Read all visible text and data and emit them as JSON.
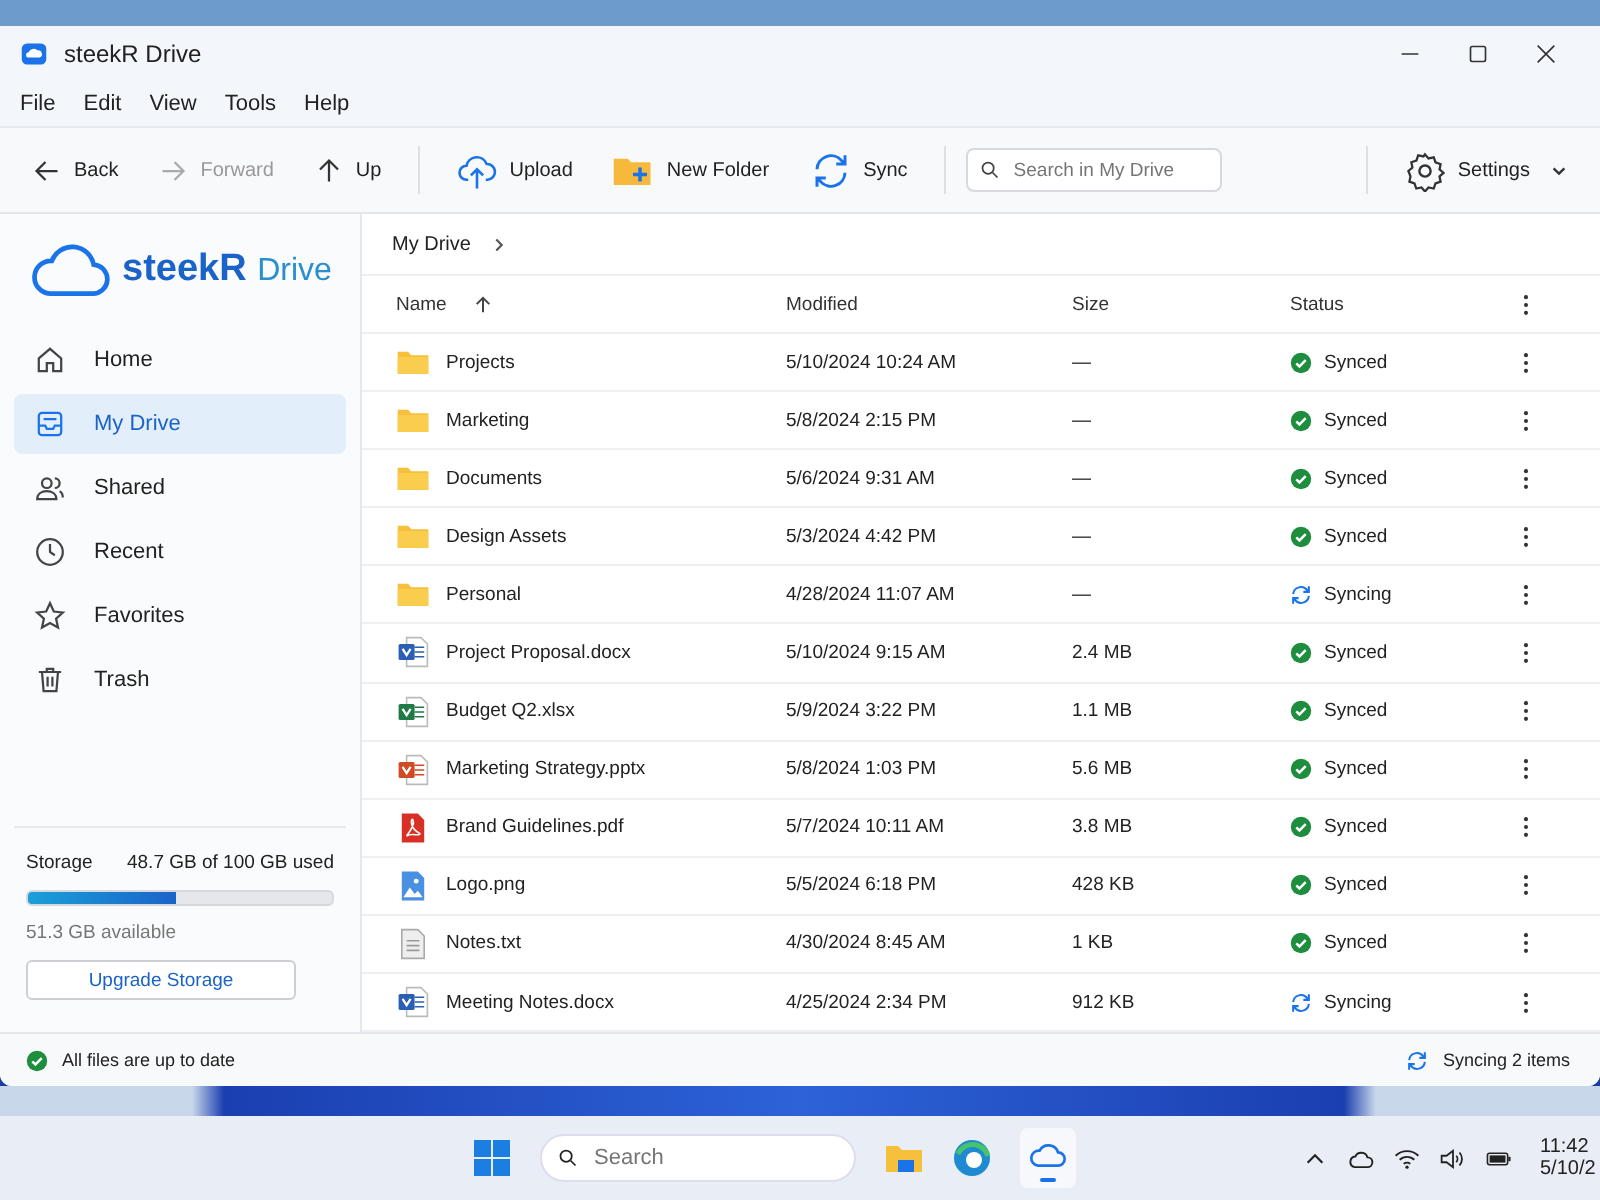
{
  "window": {
    "title": "steekR Drive"
  },
  "menu": [
    "File",
    "Edit",
    "View",
    "Tools",
    "Help"
  ],
  "toolbar": [
    {
      "kind": "back",
      "label": "Back",
      "disabled": false
    },
    {
      "kind": "forward",
      "label": "Forward",
      "disabled": true
    },
    {
      "kind": "up",
      "label": "Up",
      "disabled": false
    },
    {
      "kind": "upload",
      "label": "Upload",
      "disabled": false
    },
    {
      "kind": "newfolder",
      "label": "New Folder",
      "disabled": false
    },
    {
      "kind": "sync",
      "label": "Sync",
      "disabled": false
    }
  ],
  "search": {
    "placeholder": "Search in My Drive"
  },
  "settings": {
    "label": "Settings"
  },
  "logo": {
    "name": "steekR",
    "suffix": "Drive"
  },
  "sidebar": {
    "items": [
      {
        "kind": "home",
        "label": "Home",
        "selected": false
      },
      {
        "kind": "drive",
        "label": "My Drive",
        "selected": true
      },
      {
        "kind": "shared",
        "label": "Shared",
        "selected": false
      },
      {
        "kind": "recent",
        "label": "Recent",
        "selected": false
      },
      {
        "kind": "favorites",
        "label": "Favorites",
        "selected": false
      },
      {
        "kind": "trash",
        "label": "Trash",
        "selected": false
      }
    ]
  },
  "storage": {
    "label": "Storage",
    "used": "48.7 GB of 100 GB used",
    "level": 0.487,
    "available": "51.3 GB available",
    "button": "Upgrade Storage"
  },
  "breadcrumb": [
    "My Drive"
  ],
  "table": {
    "columns": [
      "Name",
      "Modified",
      "Size",
      "Status"
    ],
    "rows": [
      {
        "kind": "folder",
        "name": "Projects",
        "modified": "5/10/2024 10:24 AM",
        "size": "—",
        "status": {
          "kind": "synced",
          "label": "Synced"
        }
      },
      {
        "kind": "folder",
        "name": "Marketing",
        "modified": "5/8/2024 2:15 PM",
        "size": "—",
        "status": {
          "kind": "synced",
          "label": "Synced"
        }
      },
      {
        "kind": "folder",
        "name": "Documents",
        "modified": "5/6/2024 9:31 AM",
        "size": "—",
        "status": {
          "kind": "synced",
          "label": "Synced"
        }
      },
      {
        "kind": "folder",
        "name": "Design Assets",
        "modified": "5/3/2024 4:42 PM",
        "size": "—",
        "status": {
          "kind": "synced",
          "label": "Synced"
        }
      },
      {
        "kind": "folder",
        "name": "Personal",
        "modified": "4/28/2024 11:07 AM",
        "size": "—",
        "status": {
          "kind": "syncing",
          "label": "Syncing"
        }
      },
      {
        "kind": "word",
        "name": "Project Proposal.docx",
        "modified": "5/10/2024 9:15 AM",
        "size": "2.4 MB",
        "status": {
          "kind": "synced",
          "label": "Synced"
        }
      },
      {
        "kind": "excel",
        "name": "Budget Q2.xlsx",
        "modified": "5/9/2024 3:22 PM",
        "size": "1.1 MB",
        "status": {
          "kind": "synced",
          "label": "Synced"
        }
      },
      {
        "kind": "ppt",
        "name": "Marketing Strategy.pptx",
        "modified": "5/8/2024 1:03 PM",
        "size": "5.6 MB",
        "status": {
          "kind": "synced",
          "label": "Synced"
        }
      },
      {
        "kind": "pdf",
        "name": "Brand Guidelines.pdf",
        "modified": "5/7/2024 10:11 AM",
        "size": "3.8 MB",
        "status": {
          "kind": "synced",
          "label": "Synced"
        }
      },
      {
        "kind": "image",
        "name": "Logo.png",
        "modified": "5/5/2024 6:18 PM",
        "size": "428 KB",
        "status": {
          "kind": "synced",
          "label": "Synced"
        }
      },
      {
        "kind": "text",
        "name": "Notes.txt",
        "modified": "4/30/2024 8:45 AM",
        "size": "1 KB",
        "status": {
          "kind": "synced",
          "label": "Synced"
        }
      },
      {
        "kind": "word",
        "name": "Meeting Notes.docx",
        "modified": "4/25/2024 2:34 PM",
        "size": "912 KB",
        "status": {
          "kind": "syncing",
          "label": "Syncing"
        }
      }
    ]
  },
  "status_bar": {
    "left": "All files are up to date",
    "right": "Syncing 2 items"
  },
  "taskbar": {
    "search": {
      "placeholder": "Search"
    },
    "time": "11:42",
    "date": "5/10/2"
  }
}
